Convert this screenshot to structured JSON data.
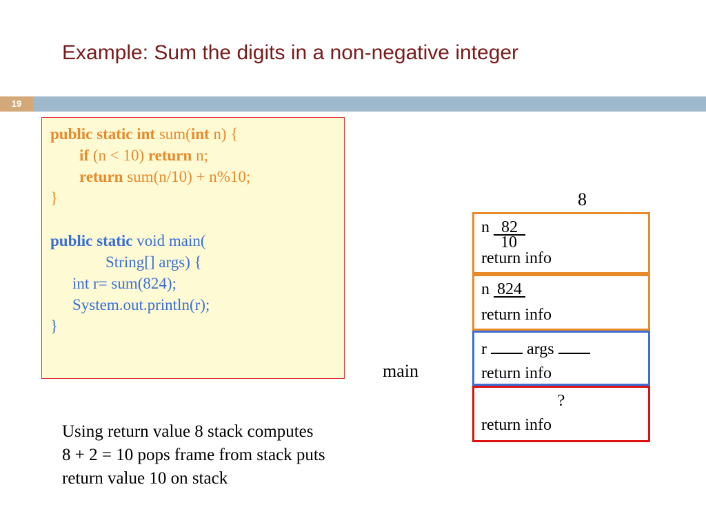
{
  "title": "Example: Sum the digits in a non-negative integer",
  "page_number": "19",
  "code": {
    "l1a": "public static int ",
    "l1b": "sum(",
    "l1c": "int ",
    "l1d": "n) {",
    "l2a": "if ",
    "l2b": "(n < 10) ",
    "l2c": "return ",
    "l2d": "n;",
    "l3a": "return ",
    "l3b": "sum(n/10)  +  n%10;",
    "l4": "}",
    "l5a": "public static ",
    "l5b": "void main(",
    "l6": "String[] args) {",
    "l7": "int r= sum(824);",
    "l8": "System.out.println(r);",
    "l9": "}"
  },
  "top_value": "8",
  "frames": {
    "f1_n": "n ",
    "f1_val1": "82",
    "f1_val2": "10",
    "f1_ret": "return info",
    "f2_n": "n ",
    "f2_val": "824",
    "f2_ret": "return info",
    "f3_r": "r ",
    "f3_args": "  args ",
    "f3_ret": "return info",
    "f4_q": "?",
    "f4_ret": "return info"
  },
  "main_label": "main",
  "caption_l1": "Using return value 8 stack computes",
  "caption_l2": " 8 + 2 = 10 pops frame from stack puts",
  "caption_l3": "return value 10 on stack"
}
